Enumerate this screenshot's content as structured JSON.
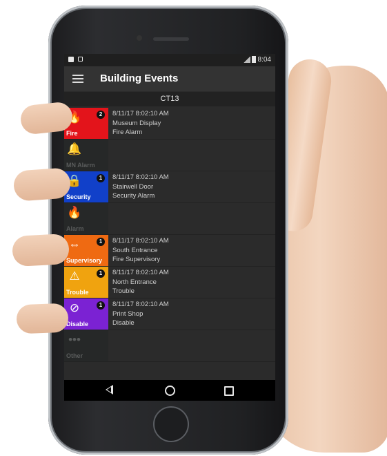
{
  "status_bar": {
    "time": "8:04"
  },
  "app_bar": {
    "title": "Building Events",
    "menu_icon": "hamburger-menu-icon"
  },
  "section_header": "CT13",
  "events": [
    {
      "category": "Fire",
      "color": "#e3141b",
      "text_color": "#ffffff",
      "icon": "flame-icon",
      "glyph": "🔥",
      "badge": "2",
      "time": "8/11/17 8:02:10 AM",
      "location": "Museum Display",
      "type": "Fire Alarm"
    },
    {
      "category": "MN Alarm",
      "color": "#262828",
      "text_color": "#5a5c5c",
      "icon": "bell-icon",
      "glyph": "🔔",
      "badge": "",
      "time": "",
      "location": "",
      "type": ""
    },
    {
      "category": "Security",
      "color": "#1140c9",
      "text_color": "#ffffff",
      "icon": "lock-icon",
      "glyph": "🔒",
      "badge": "1",
      "time": "8/11/17 8:02:10 AM",
      "location": "Stairwell Door",
      "type": "Security Alarm"
    },
    {
      "category": "Alarm",
      "color": "#262828",
      "text_color": "#5a5c5c",
      "icon": "flame-icon",
      "glyph": "🔥",
      "badge": "",
      "time": "",
      "location": "",
      "type": ""
    },
    {
      "category": "Supervisory",
      "color": "#ef6a12",
      "text_color": "#ffffff",
      "icon": "door-icon",
      "glyph": "⇔",
      "badge": "1",
      "time": "8/11/17 8:02:10 AM",
      "location": "South Entrance",
      "type": "Fire Supervisory"
    },
    {
      "category": "Trouble",
      "color": "#f0a30f",
      "text_color": "#ffffff",
      "icon": "warning-icon",
      "glyph": "⚠",
      "badge": "1",
      "time": "8/11/17 8:02:10 AM",
      "location": "North Entrance",
      "type": "Trouble"
    },
    {
      "category": "Disable",
      "color": "#7b22d3",
      "text_color": "#ffffff",
      "icon": "prohibited-icon",
      "glyph": "⊘",
      "badge": "1",
      "time": "8/11/17 8:02:10 AM",
      "location": "Print Shop",
      "type": "Disable"
    },
    {
      "category": "Other",
      "color": "#262828",
      "text_color": "#5a5c5c",
      "icon": "more-dots-icon",
      "glyph": "•••",
      "badge": "",
      "time": "",
      "location": "",
      "type": ""
    }
  ],
  "nav_bar": {
    "back": "back-icon",
    "home": "home-icon",
    "recents": "recents-icon"
  }
}
